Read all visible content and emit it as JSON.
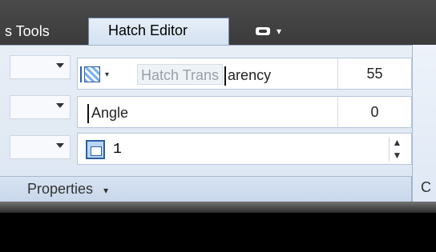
{
  "tabs": {
    "tools_label": "s Tools",
    "hatch_editor_label": "Hatch Editor",
    "overflow_icon": "panel-icon",
    "overflow_caret": "▾"
  },
  "properties_panel": {
    "transparency": {
      "icon": "hatch-transparency-icon",
      "caret": "▾",
      "placeholder_prefix": "Hatch Trans",
      "text_suffix": "arency",
      "value": "55"
    },
    "angle": {
      "label": "Angle",
      "value": "0"
    },
    "scale": {
      "icon": "hatch-scale-icon",
      "value": "1",
      "spinner_up": "▲",
      "spinner_down": "▼"
    },
    "title": "Properties",
    "title_caret": "▾",
    "side_panel_partial_label": "C"
  }
}
